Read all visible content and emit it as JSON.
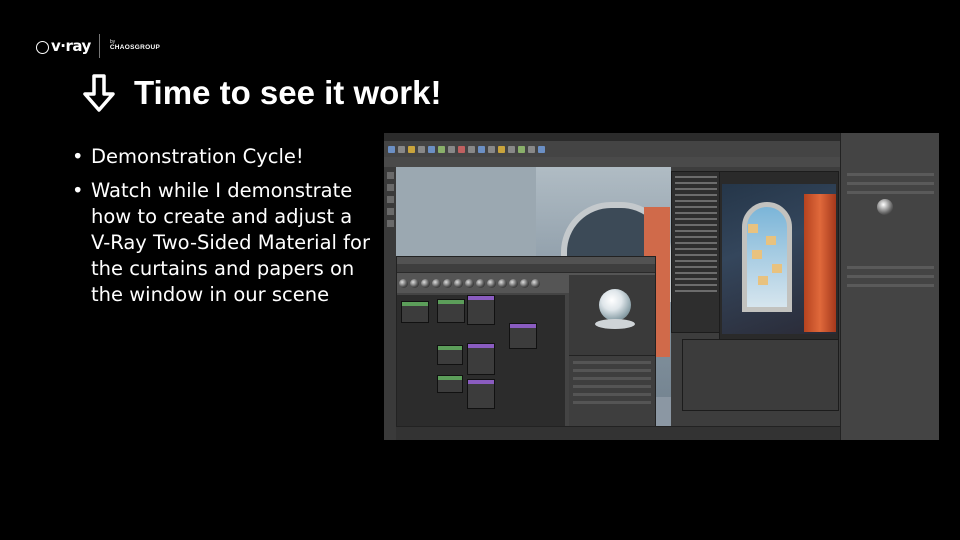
{
  "logo": {
    "brand": "v·ray",
    "by": "by",
    "company": "CHAOSGROUP"
  },
  "slide": {
    "title": "Time to see it work!",
    "title_icon": "arrow-down-icon",
    "bullets": [
      "Demonstration Cycle!",
      "Watch while I demonstrate how to create and adjust a V-Ray Two-Sided Material for the curtains and papers on the window in our scene"
    ]
  },
  "screenshot": {
    "description_icon": "maya-hypershade-screenshot",
    "colors": {
      "panel_bg": "#3d3d3d",
      "viewport_sky": "#b0bcc4",
      "curtain": "#d06a4a",
      "node_header_purple": "#8a5cc0",
      "node_header_green": "#5c9e5a"
    }
  },
  "colors": {
    "background": "#000000",
    "text": "#ffffff"
  }
}
